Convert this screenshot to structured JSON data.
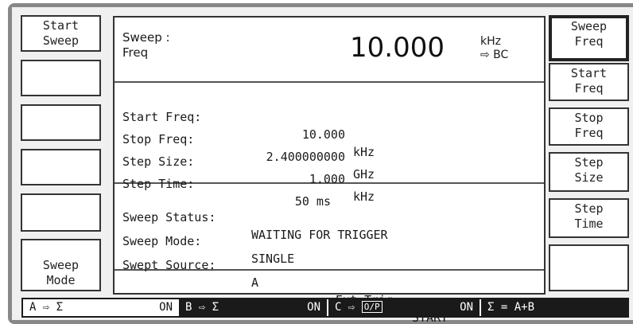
{
  "left_softkeys": [
    {
      "lines": [
        "Start",
        "Sweep"
      ]
    },
    {
      "lines": []
    },
    {
      "lines": []
    },
    {
      "lines": []
    },
    {
      "lines": []
    },
    {
      "lines": [
        "Sweep",
        "Mode"
      ]
    }
  ],
  "right_softkeys": [
    {
      "lines": [
        "Sweep",
        "Freq"
      ],
      "active": true
    },
    {
      "lines": [
        "Start",
        "Freq"
      ]
    },
    {
      "lines": [
        "Stop",
        "Freq"
      ]
    },
    {
      "lines": [
        "Step",
        "Size"
      ]
    },
    {
      "lines": [
        "Step",
        "Time"
      ]
    },
    {
      "lines": []
    }
  ],
  "header": {
    "label_line1": "Sweep :",
    "label_line2": "Freq",
    "value": "10.000",
    "unit_line1": "kHz",
    "unit_line2": "⇨ BC"
  },
  "freq_params": [
    {
      "label": "Start Freq:",
      "value": "10.000",
      "unit": "kHz"
    },
    {
      "label": "Stop Freq:",
      "value": "2.400000000",
      "unit": "GHz"
    },
    {
      "label": "Step Size:",
      "value": "1.000",
      "unit": "kHz"
    },
    {
      "label": "Step Time:",
      "value": "50 ms",
      "unit": ""
    }
  ],
  "status": {
    "status_label": "Sweep Status:",
    "status_value": "WAITING FOR TRIGGER",
    "mode_label": "Sweep Mode:",
    "mode_value": "SINGLE",
    "source_label": "Swept Source:",
    "source_value": "A",
    "ext_trig_label": "Ext Trig:",
    "ext_trig_value": "START"
  },
  "statusbar": {
    "a_label": "A ⇨ Σ",
    "a_state": "ON",
    "b_label": "B ⇨ Σ",
    "b_state": "ON",
    "c_label": "C ⇨",
    "c_boxed": "O/P",
    "c_state": "ON",
    "sum_label": "Σ = A+B"
  }
}
